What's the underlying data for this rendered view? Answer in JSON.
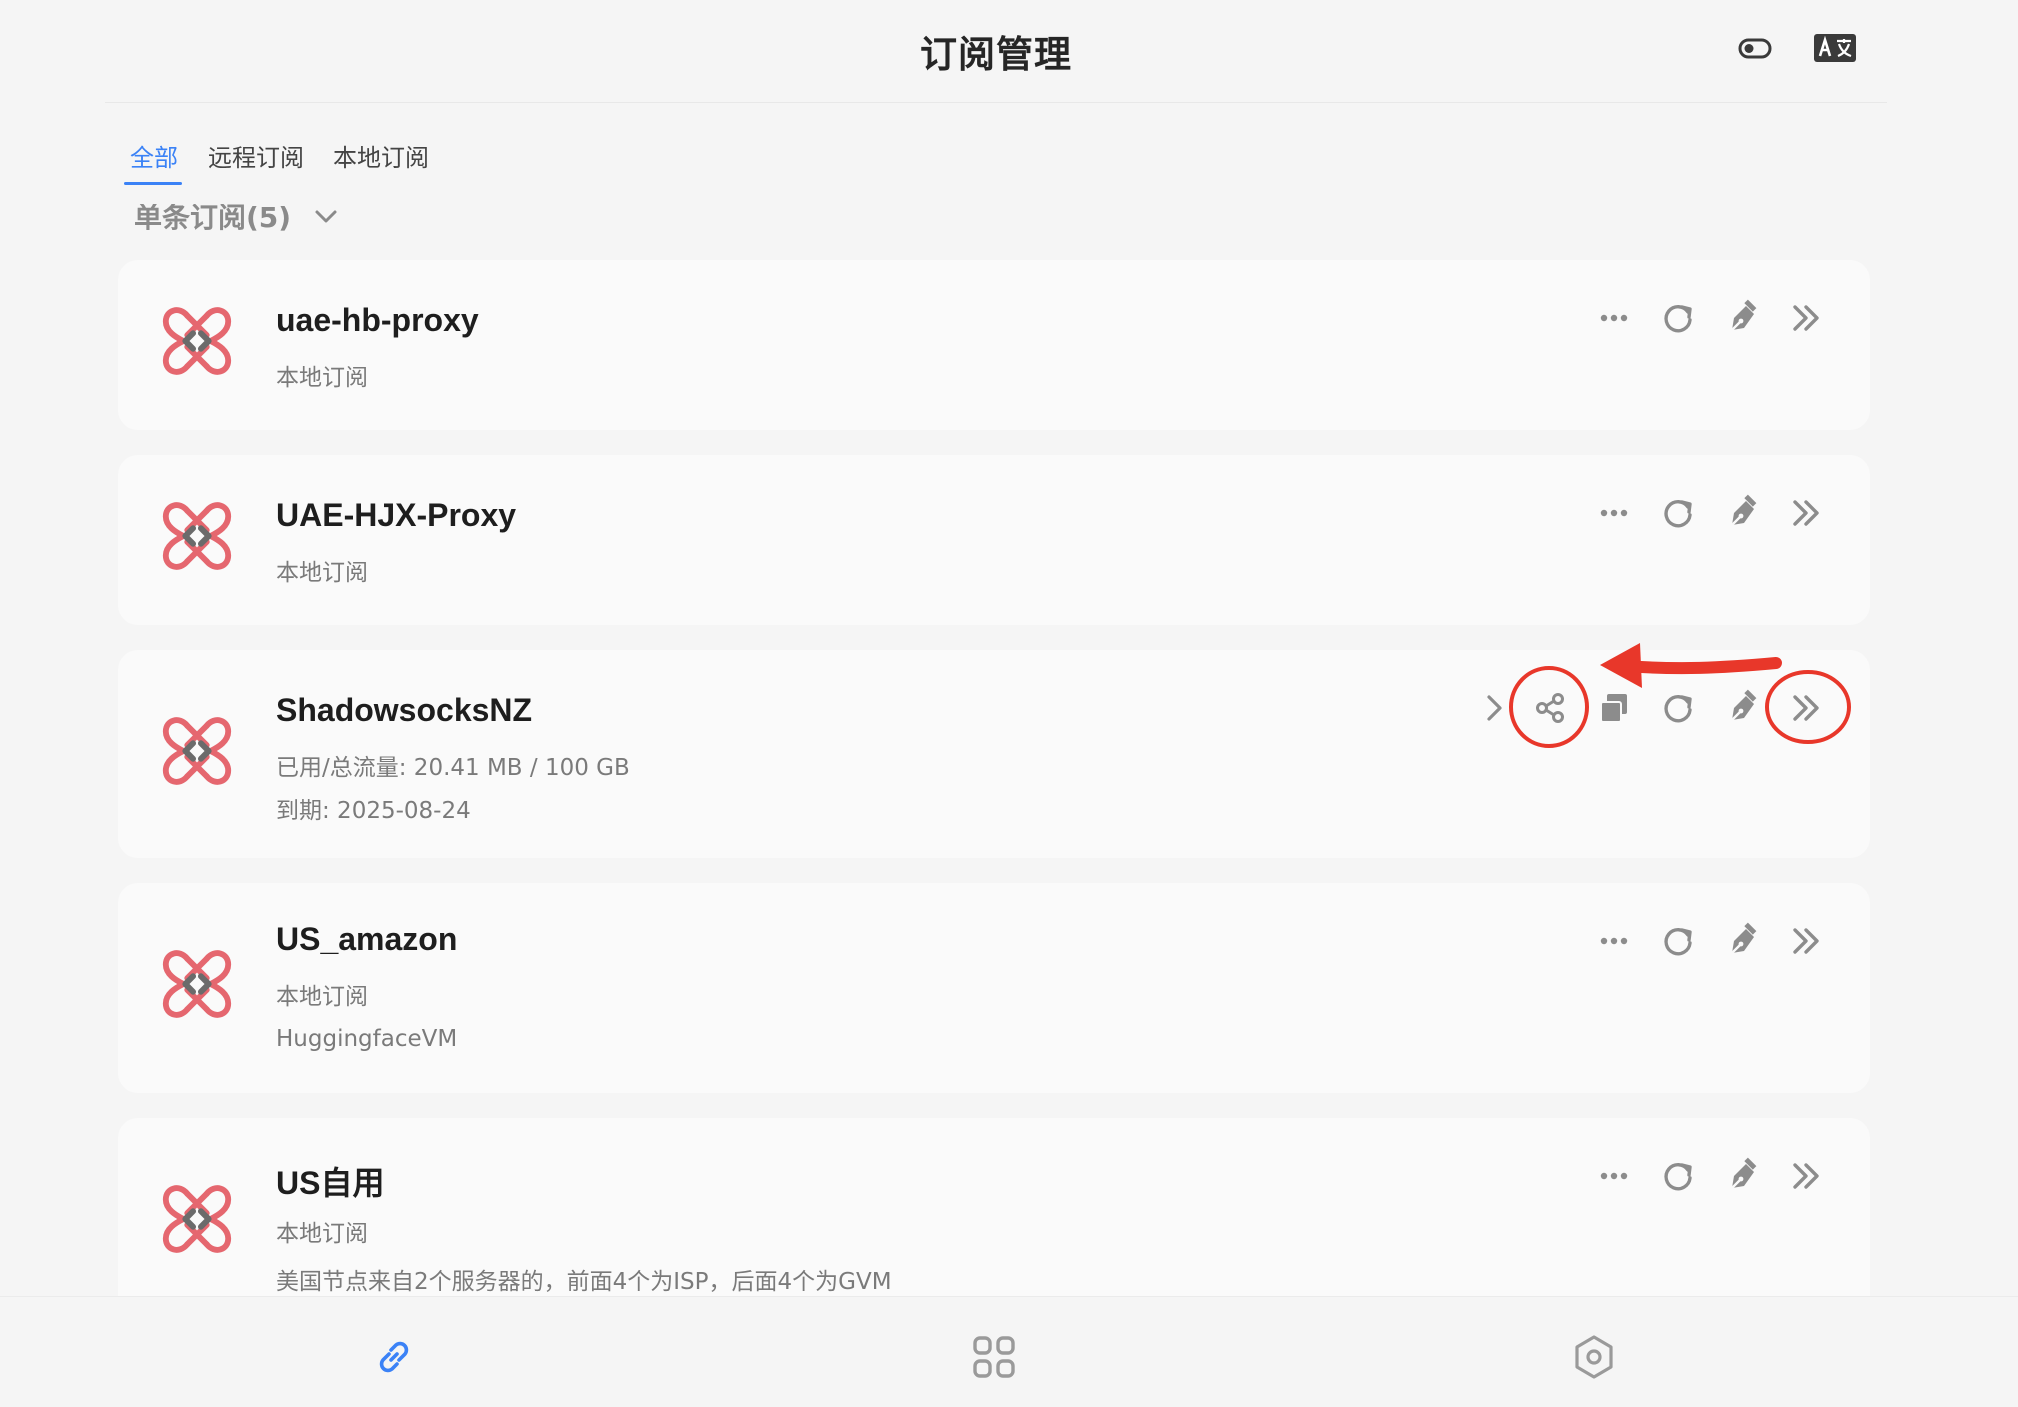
{
  "header": {
    "title": "订阅管理",
    "icons": [
      "theme-toggle-icon",
      "translate-icon"
    ]
  },
  "tabs": [
    {
      "label": "全部",
      "active": true
    },
    {
      "label": "远程订阅",
      "active": false
    },
    {
      "label": "本地订阅",
      "active": false
    }
  ],
  "group": {
    "label": "单条订阅(5)",
    "icon": "chevron-down-icon"
  },
  "subscriptions": [
    {
      "name": "uae-hb-proxy",
      "lines": [
        "本地订阅"
      ],
      "actions": [
        "more-icon",
        "refresh-icon",
        "edit-pen-icon",
        "double-chevron-right-icon"
      ]
    },
    {
      "name": "UAE-HJX-Proxy",
      "lines": [
        "本地订阅"
      ],
      "actions": [
        "more-icon",
        "refresh-icon",
        "edit-pen-icon",
        "double-chevron-right-icon"
      ]
    },
    {
      "name": "ShadowsocksNZ",
      "lines": [
        "已用/总流量: 20.41 MB / 100 GB",
        "到期: 2025-08-24"
      ],
      "actions": [
        "chevron-right-icon",
        "share-icon",
        "copy-icon",
        "refresh-icon",
        "edit-pen-icon",
        "double-chevron-right-icon"
      ]
    },
    {
      "name": "US_amazon",
      "lines": [
        "本地订阅",
        "HuggingfaceVM"
      ],
      "actions": [
        "more-icon",
        "refresh-icon",
        "edit-pen-icon",
        "double-chevron-right-icon"
      ]
    },
    {
      "name": "US自用",
      "lines": [
        "本地订阅",
        "美国节点来自2个服务器的，前面4个为ISP，后面4个为GVM"
      ],
      "actions": [
        "more-icon",
        "refresh-icon",
        "edit-pen-icon",
        "double-chevron-right-icon"
      ]
    }
  ],
  "bottom_nav": [
    "link-icon",
    "grid-icon",
    "settings-hexagon-icon"
  ],
  "colors": {
    "accent": "#3b82f6",
    "logo_red": "#e5676f",
    "logo_gray": "#6b6b6b",
    "annotation_red": "#e8372a",
    "icon_gray": "#8c8c8c"
  }
}
